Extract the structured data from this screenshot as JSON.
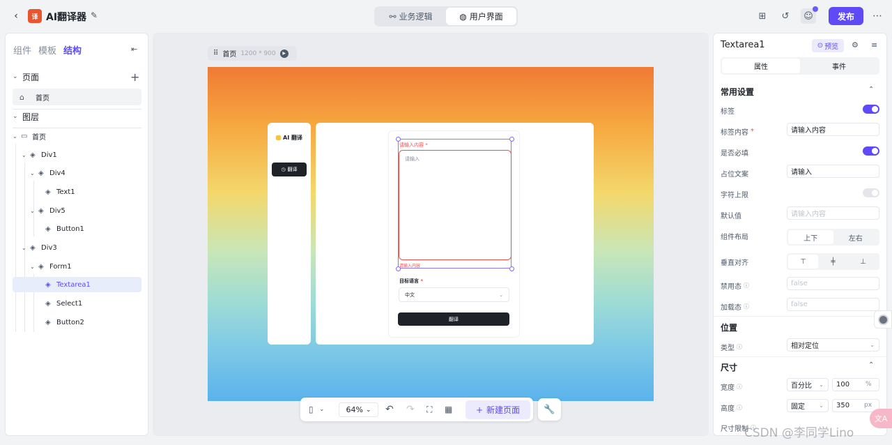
{
  "header": {
    "app_title": "AI翻译器",
    "mode_tabs": [
      {
        "label": "业务逻辑",
        "active": false
      },
      {
        "label": "用户界面",
        "active": true
      }
    ],
    "publish_label": "发布"
  },
  "left_panel": {
    "tabs": [
      {
        "label": "组件",
        "active": false
      },
      {
        "label": "模板",
        "active": false
      },
      {
        "label": "结构",
        "active": true
      }
    ],
    "pages_section": "页面",
    "pages": [
      "首页"
    ],
    "layers_section": "图层",
    "tree": [
      {
        "label": "首页",
        "depth": 0,
        "icon": "screen-icon"
      },
      {
        "label": "Div1",
        "depth": 1
      },
      {
        "label": "Div4",
        "depth": 2
      },
      {
        "label": "Text1",
        "depth": 3
      },
      {
        "label": "Div5",
        "depth": 2
      },
      {
        "label": "Button1",
        "depth": 3
      },
      {
        "label": "Div3",
        "depth": 1
      },
      {
        "label": "Form1",
        "depth": 2
      },
      {
        "label": "Textarea1",
        "depth": 3,
        "selected": true
      },
      {
        "label": "Select1",
        "depth": 3
      },
      {
        "label": "Button2",
        "depth": 3
      }
    ]
  },
  "canvas": {
    "crumb_page": "首页",
    "crumb_size": "1200 * 900",
    "preview": {
      "logo": "AI 翻译",
      "nav_button": "翻译",
      "field_label": "请输入内容",
      "placeholder": "请输入",
      "error": "请输入内容",
      "lang_label": "目标语言",
      "lang_value": "中文",
      "submit": "翻译"
    },
    "zoom": "64%",
    "new_page": "新建页面"
  },
  "right_panel": {
    "component": "Textarea1",
    "preview_label": "预览",
    "tabs": [
      {
        "label": "属性",
        "active": true
      },
      {
        "label": "事件",
        "active": false
      }
    ],
    "general_section": "常用设置",
    "label_row": "标签",
    "label_content_row": "标签内容",
    "label_content_value": "请输入内容",
    "required_row": "是否必填",
    "placeholder_row": "占位文案",
    "placeholder_value": "请输入",
    "maxlen_row": "字符上限",
    "default_row": "默认值",
    "default_placeholder": "请输入内容",
    "layout_row": "组件布局",
    "layout_options": [
      "上下",
      "左右"
    ],
    "valign_row": "垂直对齐",
    "disabled_row": "禁用态",
    "disabled_value": "false",
    "loading_row": "加载态",
    "loading_value": "false",
    "position_section": "位置",
    "type_row": "类型",
    "type_value": "相对定位",
    "size_section": "尺寸",
    "width_row": "宽度",
    "width_mode": "百分比",
    "width_value": "100",
    "width_unit": "%",
    "height_row": "高度",
    "height_mode": "固定",
    "height_value": "350",
    "height_unit": "px",
    "size_limit_row": "尺寸限制"
  },
  "watermark": "CSDN @李同学Lino",
  "colors": {
    "accent": "#5e4bf5",
    "error": "#f04d4d",
    "dark": "#1f2329"
  }
}
